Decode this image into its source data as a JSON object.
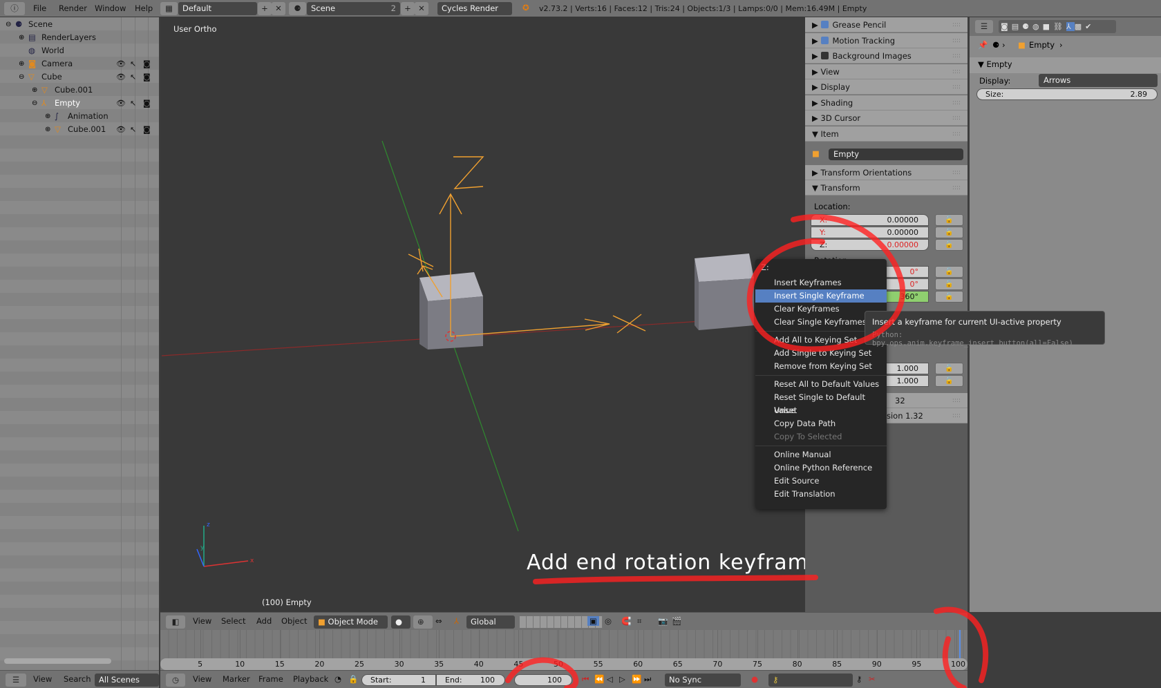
{
  "topbar": {
    "menus": [
      "File",
      "Render",
      "Window",
      "Help"
    ],
    "screen_layout": "Default",
    "scene": "Scene",
    "scene_users": "2",
    "render_engine": "Cycles Render",
    "stats": "v2.73.2 | Verts:16 | Faces:12 | Tris:24 | Objects:1/3 | Lamps:0/0 | Mem:16.49M | Empty"
  },
  "outliner": {
    "items": [
      {
        "label": "Scene",
        "icon": "scene-icon",
        "depth": 0,
        "expand": "collapse"
      },
      {
        "label": "RenderLayers",
        "icon": "render-layers-icon",
        "depth": 1,
        "expand": "expand"
      },
      {
        "label": "World",
        "icon": "world-icon",
        "depth": 1,
        "expand": ""
      },
      {
        "label": "Camera",
        "icon": "camera-icon",
        "depth": 1,
        "expand": "expand",
        "toggles": true
      },
      {
        "label": "Cube",
        "icon": "mesh-icon",
        "depth": 1,
        "expand": "collapse",
        "toggles": true
      },
      {
        "label": "Cube.001",
        "icon": "mesh-data-icon",
        "depth": 2,
        "expand": "expand"
      },
      {
        "label": "Empty",
        "icon": "empty-icon",
        "depth": 2,
        "expand": "collapse",
        "toggles": true,
        "selected": true
      },
      {
        "label": "Animation",
        "icon": "animation-icon",
        "depth": 3,
        "expand": "expand"
      },
      {
        "label": "Cube.001",
        "icon": "mesh-icon",
        "depth": 3,
        "expand": "expand",
        "toggles": true
      }
    ],
    "footer": {
      "view": "View",
      "search": "Search",
      "filter": "All Scenes"
    }
  },
  "viewport": {
    "view_name": "User Ortho",
    "object_info": "(100) Empty",
    "caption": "Add end rotation keyframe.",
    "header": {
      "view": "View",
      "select": "Select",
      "add": "Add",
      "object": "Object",
      "mode": "Object Mode",
      "orientation": "Global"
    },
    "gizmo": {
      "x": "x",
      "y": "y",
      "z": "z"
    }
  },
  "npanel": {
    "panels": [
      "Grease Pencil",
      "Motion Tracking",
      "Background Images",
      "View",
      "Display",
      "Shading",
      "3D Cursor",
      "Item"
    ],
    "item_name": "Empty",
    "transform_orientations": "Transform Orientations",
    "transform": "Transform",
    "location_label": "Location:",
    "location": [
      {
        "axis": "X:",
        "value": "0.00000"
      },
      {
        "axis": "Y:",
        "value": "0.00000"
      },
      {
        "axis": "Z:",
        "value": "0.00000"
      }
    ],
    "rotation_label": "Rotation:",
    "rotation": [
      "0°",
      "0°",
      "360°"
    ],
    "scale": [
      "1.000",
      "1.000"
    ],
    "partial": [
      "32",
      "sion 1.32"
    ]
  },
  "properties": {
    "breadcrumb": "Empty",
    "panel": "Empty",
    "display_label": "Display:",
    "display_value": "Arrows",
    "size_label": "Size:",
    "size_value": "2.89"
  },
  "context_menu": {
    "title": "Z:",
    "groups": [
      [
        "Insert Keyframes",
        "Insert Single Keyframe",
        "Clear Keyframes",
        "Clear Single Keyframes"
      ],
      [
        "Add All to Keying Set",
        "Add Single to Keying Set",
        "Remove from Keying Set"
      ],
      [
        "Reset All to Default Values",
        "Reset Single to Default Value",
        "Unset",
        "Copy Data Path",
        "Copy To Selected"
      ],
      [
        "Online Manual",
        "Online Python Reference",
        "Edit Source",
        "Edit Translation"
      ]
    ],
    "highlighted": "Insert Single Keyframe",
    "disabled": [
      "Copy To Selected"
    ]
  },
  "tooltip": {
    "text": "Insert a keyframe for current UI-active property",
    "python": "Python: bpy.ops.anim.keyframe_insert_button(all=False)"
  },
  "timeline": {
    "ticks": [
      "5",
      "10",
      "15",
      "20",
      "25",
      "30",
      "35",
      "40",
      "45",
      "50",
      "55",
      "60",
      "65",
      "70",
      "75",
      "80",
      "85",
      "90",
      "95",
      "100"
    ],
    "current_frame": 100,
    "header": {
      "view": "View",
      "marker": "Marker",
      "frame": "Frame",
      "playback": "Playback",
      "start_label": "Start:",
      "start": "1",
      "end_label": "End:",
      "end": "100",
      "current": "100",
      "sync": "No Sync"
    }
  },
  "colors": {
    "highlight": "#5680c2",
    "annotation": "#ff2020",
    "empty_orange": "#f0a030",
    "keyed_green": "#8fcf6f"
  }
}
